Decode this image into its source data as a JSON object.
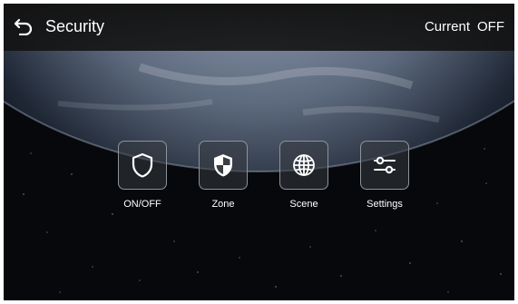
{
  "header": {
    "back_icon": "back-arrow-icon",
    "title": "Security",
    "status_label": "Current",
    "status_value": "OFF"
  },
  "menu": {
    "items": [
      {
        "label": "ON/OFF",
        "icon": "shield-outline-icon"
      },
      {
        "label": "Zone",
        "icon": "shield-half-icon"
      },
      {
        "label": "Scene",
        "icon": "globe-icon"
      },
      {
        "label": "Settings",
        "icon": "sliders-icon"
      }
    ]
  },
  "colors": {
    "topbar": "#121212",
    "text": "#ffffff",
    "tile_border": "#8f9297",
    "space": "#06080c",
    "earth_light": "#9aa9bf"
  }
}
